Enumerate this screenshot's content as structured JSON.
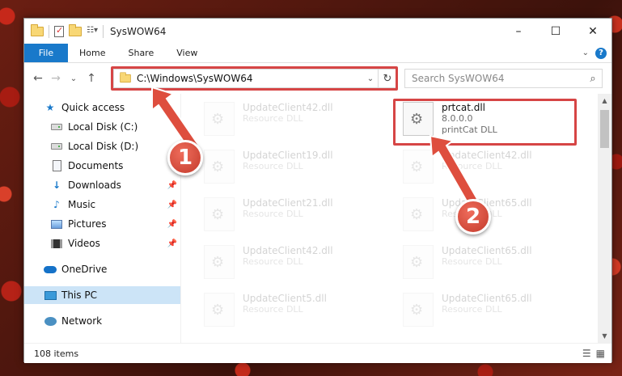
{
  "window": {
    "title": "SysWOW64",
    "buttons": {
      "minimize": "–",
      "maximize": "☐",
      "close": "✕"
    }
  },
  "ribbon": {
    "tabs": [
      "File",
      "Home",
      "Share",
      "View"
    ]
  },
  "nav": {
    "back": "←",
    "forward": "→",
    "recent": "⌄",
    "up": "↑",
    "address": "C:\\Windows\\SysWOW64",
    "search_placeholder": "Search SysWOW64"
  },
  "sidebar": {
    "items": [
      {
        "label": "Quick access",
        "icon": "star-icon"
      },
      {
        "label": "Local Disk (C:)",
        "icon": "drive-icon"
      },
      {
        "label": "Local Disk (D:)",
        "icon": "drive-icon"
      },
      {
        "label": "Documents",
        "icon": "document-icon"
      },
      {
        "label": "Downloads",
        "icon": "download-icon"
      },
      {
        "label": "Music",
        "icon": "music-icon"
      },
      {
        "label": "Pictures",
        "icon": "pictures-icon"
      },
      {
        "label": "Videos",
        "icon": "video-icon"
      },
      {
        "label": "OneDrive",
        "icon": "cloud-icon"
      },
      {
        "label": "This PC",
        "icon": "computer-icon"
      },
      {
        "label": "Network",
        "icon": "network-icon"
      }
    ]
  },
  "files": {
    "highlighted": {
      "name": "prtcat.dll",
      "version": "8.0.0.0",
      "description": "printCat DLL"
    },
    "faded": [
      {
        "name": "UpdateClient42.dll",
        "type": "Resource DLL"
      },
      {
        "name": "UpdateClient19.dll",
        "type": "Resource DLL"
      },
      {
        "name": "UpdateClient42.dll",
        "type": "Resource DLL"
      },
      {
        "name": "UpdateClient21.dll",
        "type": "Resource DLL"
      },
      {
        "name": "UpdateClient65.dll",
        "type": "Resource DLL"
      },
      {
        "name": "UpdateClient42.dll",
        "type": "Resource DLL"
      },
      {
        "name": "UpdateClient65.dll",
        "type": "Resource DLL"
      },
      {
        "name": "UpdateClient5.dll",
        "type": "Resource DLL"
      },
      {
        "name": "UpdateClient65.dll",
        "type": "Resource DLL"
      }
    ]
  },
  "status": {
    "item_count": "108 items"
  },
  "annotations": {
    "step1": "1",
    "step2": "2"
  },
  "colors": {
    "accent": "#1979ca",
    "highlight": "#d64545",
    "selection": "#cce4f7"
  }
}
